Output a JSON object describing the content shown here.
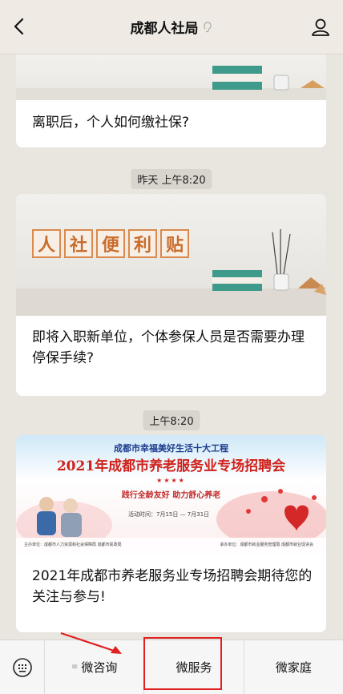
{
  "header": {
    "title": "成都人社局",
    "back_icon": "chevron-left-icon",
    "profile_icon": "user-icon",
    "title_icon": "ear-icon"
  },
  "feed": {
    "articles": [
      {
        "title": "离职后，个人如何缴社保?"
      },
      {
        "time": "昨天 上午8:20",
        "cover_tiles": [
          "人",
          "社",
          "便",
          "利",
          "贴"
        ],
        "title": "即将入职新单位，个体参保人员是否需要办理停保手续?"
      },
      {
        "time": "上午8:20",
        "poster": {
          "top_line": "成都市幸福美好生活十大工程",
          "main_line": "2021年成都市养老服务业专场招聘会",
          "stars": "★★★★",
          "slogan": "践行全龄友好  助力舒心养老",
          "date": "活动时间：7月15日 — 7月31日",
          "foot_left": "主办单位：成都市人力资源和社会保障局  成都市民政局",
          "foot_right": "承办单位：成都市就业服务管理局  成都市就业促进会"
        },
        "title": "2021年成都市养老服务业专场招聘会期待您的关注与参与!"
      }
    ]
  },
  "bottom_menu": {
    "keyboard_icon": "keyboard-icon",
    "items": [
      "微咨询",
      "微服务",
      "微家庭"
    ],
    "submenu_marker": "≡",
    "highlight_color": "#e02020"
  }
}
